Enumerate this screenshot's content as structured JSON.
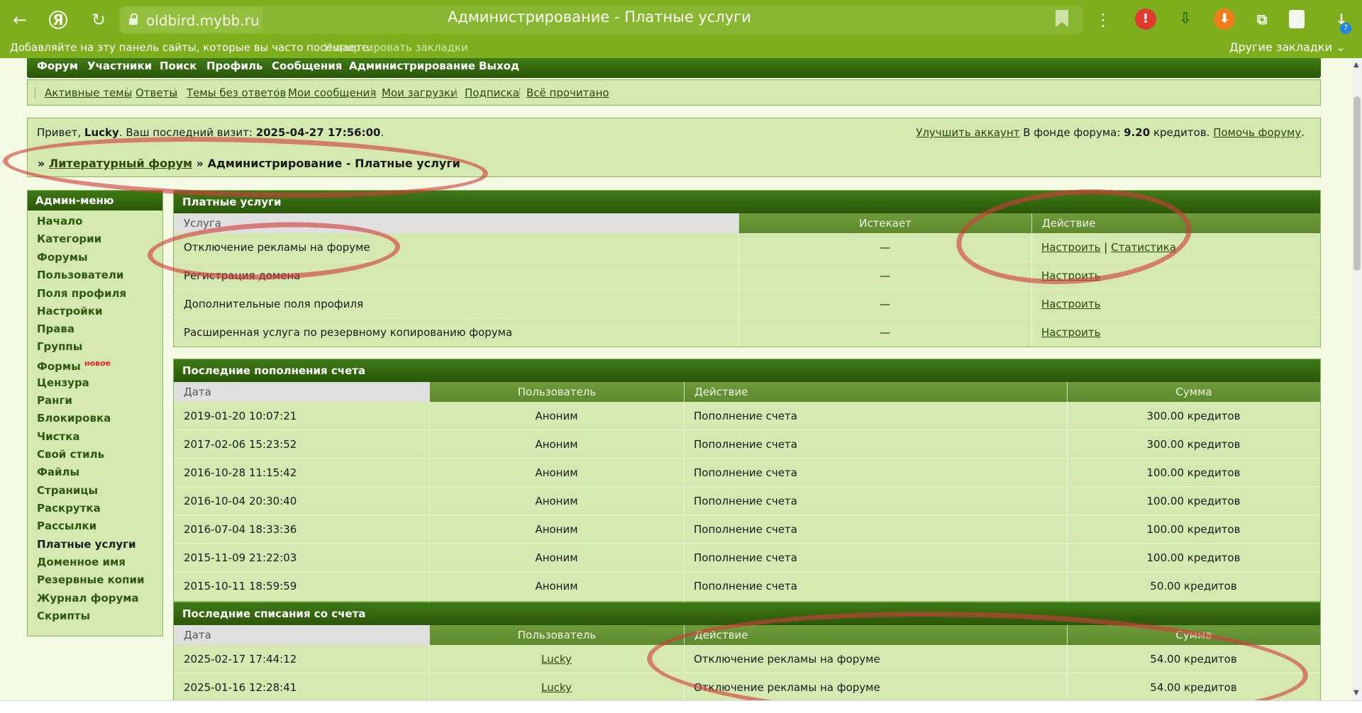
{
  "browser": {
    "url": "oldbird.mybb.ru",
    "title": "Администрирование - Платные услуги",
    "bookmark_hint": "Добавляйте на эту панель сайты, которые вы часто посещаете.",
    "import_link": "Импортировать закладки",
    "other_bookmarks": "Другие закладки ⌄",
    "back_icon": "←",
    "yandex_icon": "Я",
    "reload_icon": "↻",
    "menu_icon": "⋮",
    "badge_count": "7",
    "theme_color": "#7cae1e"
  },
  "nav": {
    "main": [
      "Форум",
      "Участники",
      "Поиск",
      "Профиль",
      "Сообщения",
      "Администрирование",
      "Выход"
    ],
    "sub": [
      "Активные темы",
      "Ответы",
      "Темы без ответов",
      "Мои сообщения",
      "Мои загрузки",
      "Подписка",
      "Всё прочитано"
    ]
  },
  "welcome": {
    "greet": "Привет,",
    "user": "Lucky",
    "last_visit_label": ". Ваш последний визит:",
    "last_visit": "2025-04-27 17:56:00",
    "upgrade": "Улучшить аккаунт",
    "fund_label": "В фонде форума:",
    "fund_value": "9.20",
    "fund_unit": "кредитов.",
    "help": "Помочь форуму"
  },
  "breadcrumb": {
    "sep": "»",
    "forum": "Литературный форум",
    "current": "» Администрирование - Платные услуги"
  },
  "sidebar": {
    "title": "Админ-меню",
    "items": [
      "Начало",
      "Категории",
      "Форумы",
      "Пользователи",
      "Поля профиля",
      "Настройки",
      "Права",
      "Группы",
      "Формы",
      "Цензура",
      "Ранги",
      "Блокировка",
      "Чистка",
      "Свой стиль",
      "Файлы",
      "Страницы",
      "Раскрутка",
      "Рассылки",
      "Платные услуги",
      "Доменное имя",
      "Резервные копии",
      "Журнал форума",
      "Скрипты"
    ],
    "new_badge": "новое"
  },
  "services": {
    "title": "Платные услуги",
    "columns": [
      "Услуга",
      "Истекает",
      "Действие"
    ],
    "rows": [
      {
        "name": "Отключение рекламы на форуме",
        "expires": "—",
        "action": "Настроить",
        "sep": "|",
        "action2": "Статистика"
      },
      {
        "name": "Регистрация домена",
        "expires": "—",
        "action": "Настроить"
      },
      {
        "name": "Дополнительные поля профиля",
        "expires": "—",
        "action": "Настроить"
      },
      {
        "name": "Расширенная услуга по резервному копированию форума",
        "expires": "—",
        "action": "Настроить"
      }
    ]
  },
  "deposits": {
    "title": "Последние пополнения счета",
    "columns": [
      "Дата",
      "Пользователь",
      "Действие",
      "Сумма"
    ],
    "rows": [
      {
        "date": "2019-01-20 10:07:21",
        "user": "Аноним",
        "action": "Пополнение счета",
        "sum": "300.00 кредитов"
      },
      {
        "date": "2017-02-06 15:23:52",
        "user": "Аноним",
        "action": "Пополнение счета",
        "sum": "300.00 кредитов"
      },
      {
        "date": "2016-10-28 11:15:42",
        "user": "Аноним",
        "action": "Пополнение счета",
        "sum": "100.00 кредитов"
      },
      {
        "date": "2016-10-04 20:30:40",
        "user": "Аноним",
        "action": "Пополнение счета",
        "sum": "100.00 кредитов"
      },
      {
        "date": "2016-07-04 18:33:36",
        "user": "Аноним",
        "action": "Пополнение счета",
        "sum": "100.00 кредитов"
      },
      {
        "date": "2015-11-09 21:22:03",
        "user": "Аноним",
        "action": "Пополнение счета",
        "sum": "100.00 кредитов"
      },
      {
        "date": "2015-10-11 18:59:59",
        "user": "Аноним",
        "action": "Пополнение счета",
        "sum": "50.00 кредитов"
      }
    ]
  },
  "withdrawals": {
    "title": "Последние списания со счета",
    "columns": [
      "Дата",
      "Пользователь",
      "Действие",
      "Сумма"
    ],
    "rows": [
      {
        "date": "2025-02-17 17:44:12",
        "user": "Lucky",
        "action": "Отключение рекламы на форуме",
        "sum": "54.00 кредитов"
      },
      {
        "date": "2025-01-16 12:28:41",
        "user": "Lucky",
        "action": "Отключение рекламы на форуме",
        "sum": "54.00 кредитов"
      }
    ]
  }
}
